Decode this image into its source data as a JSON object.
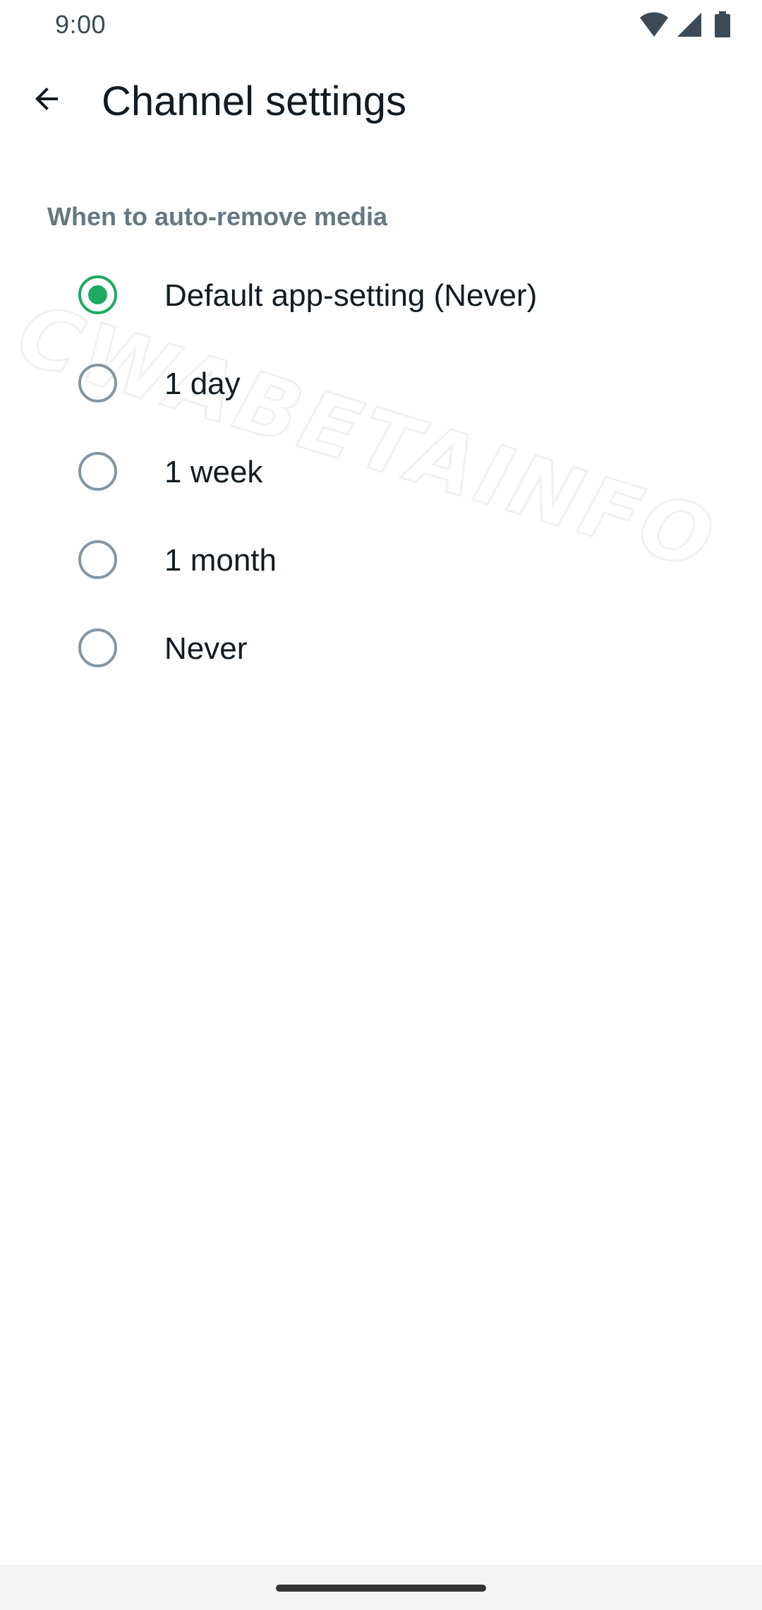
{
  "status_bar": {
    "time": "9:00",
    "icons": [
      "wifi-icon",
      "cellular-signal-icon",
      "battery-icon"
    ]
  },
  "app_bar": {
    "back_icon": "arrow-left-icon",
    "title": "Channel settings"
  },
  "watermark": {
    "text": "CWABETAINFO"
  },
  "section": {
    "header": "When to auto-remove media",
    "options": [
      {
        "label": "Default app-setting (Never)",
        "selected": true
      },
      {
        "label": "1 day",
        "selected": false
      },
      {
        "label": "1 week",
        "selected": false
      },
      {
        "label": "1 month",
        "selected": false
      },
      {
        "label": "Never",
        "selected": false
      }
    ]
  },
  "colors": {
    "accent": "#1daa61",
    "radio_unselected": "#8696a0",
    "header_text": "#667781",
    "primary_text": "#111b21"
  }
}
